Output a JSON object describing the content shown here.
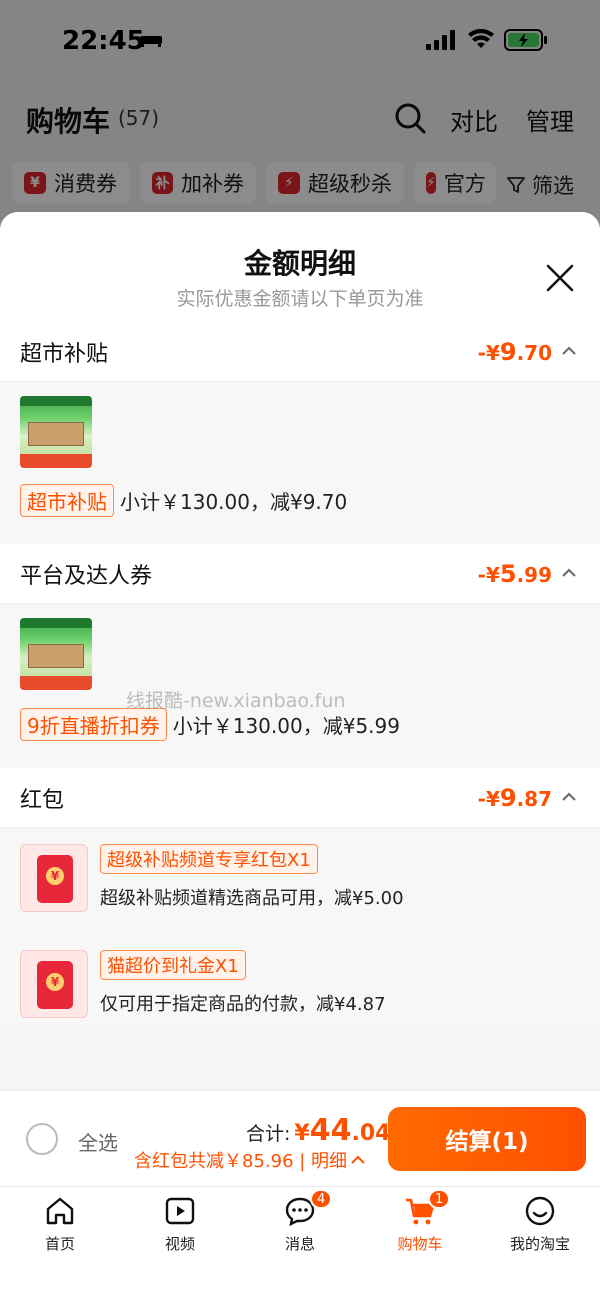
{
  "status_bar": {
    "time": "22:45"
  },
  "header": {
    "title": "购物车",
    "count": "(57)",
    "compare": "对比",
    "manage": "管理"
  },
  "chips": [
    {
      "icon": "¥",
      "label": "消费券"
    },
    {
      "icon": "补",
      "label": "加补券"
    },
    {
      "icon": "⚡",
      "label": "超级秒杀"
    },
    {
      "icon": "⚡",
      "label": "官方"
    }
  ],
  "filter": {
    "label": "筛选"
  },
  "sheet": {
    "title": "金额明细",
    "subtitle": "实际优惠金额请以下单页为准"
  },
  "sections": {
    "market": {
      "name": "超市补贴",
      "amount_prefix": "-¥",
      "amount_int": "9",
      "amount_dec": ".70",
      "tag": "超市补贴",
      "detail": "小计￥130.00，减¥9.70"
    },
    "platform": {
      "name": "平台及达人券",
      "amount_prefix": "-¥",
      "amount_int": "5",
      "amount_dec": ".99",
      "tag": "9折直播折扣券",
      "detail": "小计￥130.00，减¥5.99"
    },
    "redpacket": {
      "name": "红包",
      "amount_prefix": "-¥",
      "amount_int": "9",
      "amount_dec": ".87",
      "items": [
        {
          "tag": "超级补贴频道专享红包X1",
          "desc": "超级补贴频道精选商品可用，减¥5.00"
        },
        {
          "tag": "猫超价到礼金X1",
          "desc": "仅可用于指定商品的付款，减¥4.87"
        }
      ]
    }
  },
  "watermark": "线报酷-new.xianbao.fun",
  "checkout": {
    "select_all": "全选",
    "total_label": "合计:",
    "total_prefix": "¥",
    "total_int": "44",
    "total_dec": ".04",
    "discount": "含红包共减￥85.96 | 明细",
    "button": "结算(1)"
  },
  "tabbar": [
    {
      "label": "首页",
      "icon": "home-icon"
    },
    {
      "label": "视频",
      "icon": "video-icon"
    },
    {
      "label": "消息",
      "icon": "message-icon",
      "badge": "4"
    },
    {
      "label": "购物车",
      "icon": "cart-icon",
      "badge": "1",
      "active": true
    },
    {
      "label": "我的淘宝",
      "icon": "profile-icon"
    }
  ],
  "colors": {
    "accent": "#ff5000",
    "red": "#e0262d"
  }
}
